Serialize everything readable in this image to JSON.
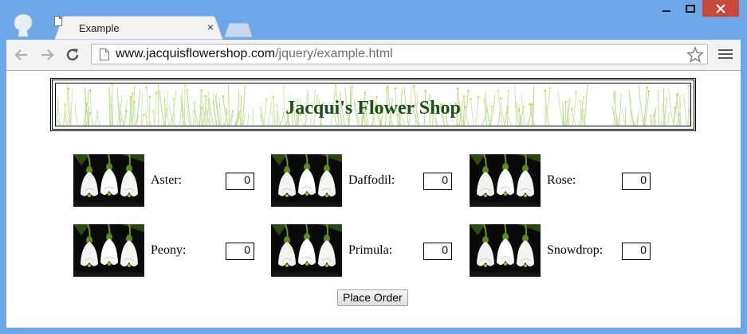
{
  "browser": {
    "tab_title": "Example",
    "tab_close": "×",
    "url_host": "www.jacquisflowershop.com",
    "url_path": "/jquery/example.html"
  },
  "page": {
    "shop_title": "Jacqui's Flower Shop",
    "flowers": [
      {
        "label": "Aster:",
        "quantity": "0"
      },
      {
        "label": "Daffodil:",
        "quantity": "0"
      },
      {
        "label": "Rose:",
        "quantity": "0"
      },
      {
        "label": "Peony:",
        "quantity": "0"
      },
      {
        "label": "Primula:",
        "quantity": "0"
      },
      {
        "label": "Snowdrop:",
        "quantity": "0"
      }
    ],
    "order_button": "Place Order"
  },
  "colors": {
    "title_green": "#1b4f1b",
    "window_blue": "#6ea7e8",
    "close_red": "#c7493a"
  },
  "icons": [
    "user-avatar-icon",
    "page-icon",
    "close-icon",
    "minimize-icon",
    "maximize-icon",
    "back-arrow-icon",
    "forward-arrow-icon",
    "reload-icon",
    "star-icon",
    "menu-icon",
    "flower-thumbnail"
  ]
}
